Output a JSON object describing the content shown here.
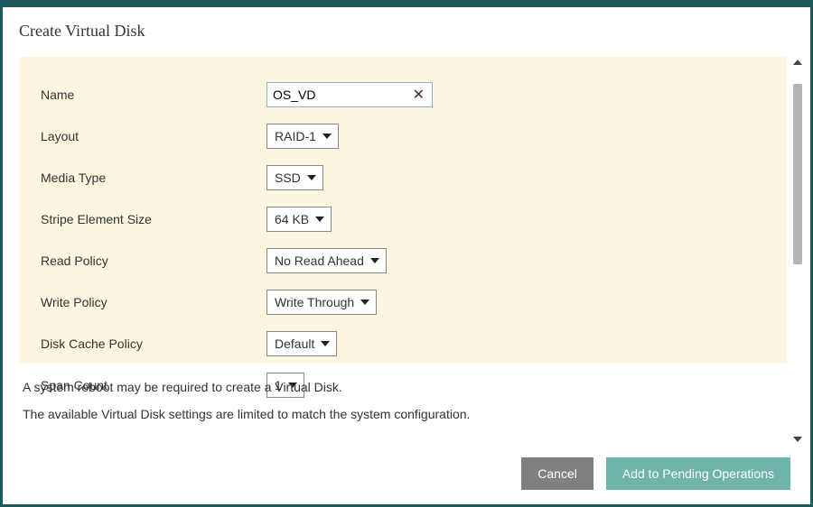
{
  "modal": {
    "title": "Create Virtual Disk"
  },
  "form": {
    "name": {
      "label": "Name",
      "value": "OS_VD"
    },
    "layout": {
      "label": "Layout",
      "value": "RAID-1"
    },
    "media_type": {
      "label": "Media Type",
      "value": "SSD"
    },
    "stripe_size": {
      "label": "Stripe Element Size",
      "value": "64 KB"
    },
    "read_policy": {
      "label": "Read Policy",
      "value": "No Read Ahead"
    },
    "write_policy": {
      "label": "Write Policy",
      "value": "Write Through"
    },
    "disk_cache": {
      "label": "Disk Cache Policy",
      "value": "Default"
    },
    "span_count": {
      "label": "Span Count",
      "value": "1"
    }
  },
  "notes": {
    "reboot": "A system reboot may be required to create a Virtual Disk.",
    "limited": "The available Virtual Disk settings are limited to match the system configuration."
  },
  "buttons": {
    "cancel": "Cancel",
    "add": "Add to Pending Operations"
  }
}
